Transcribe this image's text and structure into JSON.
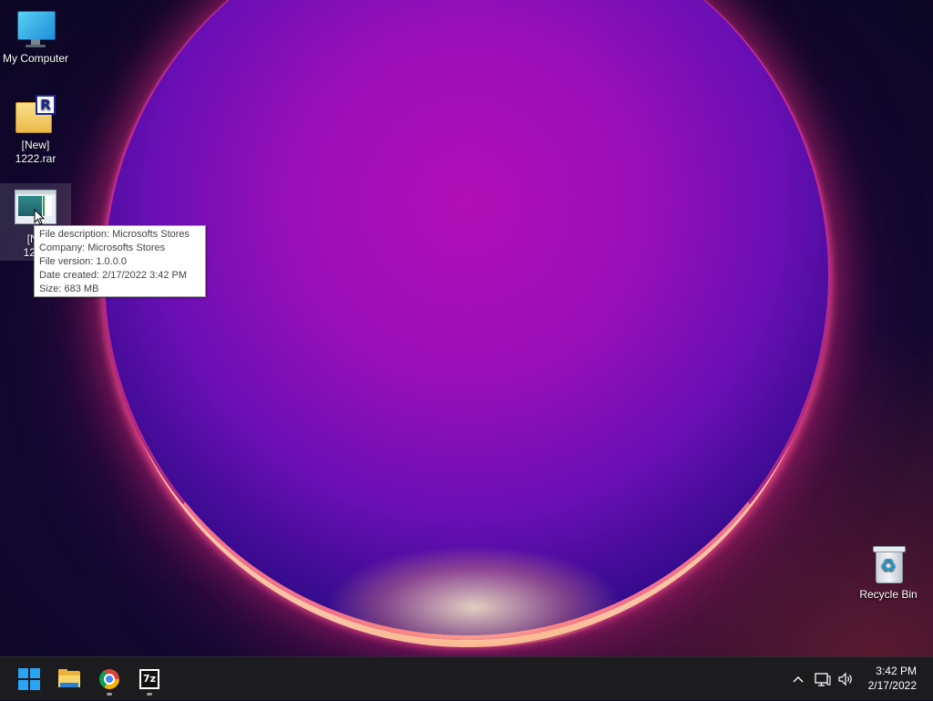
{
  "desktop": {
    "icons": {
      "my_computer": {
        "label": "My Computer"
      },
      "rar_file": {
        "label_line1": "[New]",
        "label_line2": "1222.rar",
        "badge": "R"
      },
      "app_file": {
        "label_line1": "[Ne",
        "label_line2": "1222"
      },
      "recycle_bin": {
        "label": "Recycle Bin"
      }
    },
    "tooltip": {
      "lines": [
        "File description: Microsofts Stores",
        "Company: Microsofts Stores",
        "File version: 1.0.0.0",
        "Date created: 2/17/2022 3:42 PM",
        "Size: 683 MB"
      ]
    }
  },
  "taskbar": {
    "pinned": [
      {
        "name": "start",
        "icon": "windows-logo-icon"
      },
      {
        "name": "file-explorer",
        "icon": "folder-icon"
      },
      {
        "name": "chrome",
        "icon": "chrome-icon"
      },
      {
        "name": "7-zip",
        "icon": "seven-zip-icon",
        "text": "7z"
      }
    ],
    "tray": {
      "chevron": "^",
      "clock_time": "3:42 PM",
      "clock_date": "2/17/2022"
    }
  },
  "colors": {
    "accent": "#2aa4f4",
    "taskbar_bg": "#1c1c1e",
    "tooltip_bg": "#ffffff"
  }
}
